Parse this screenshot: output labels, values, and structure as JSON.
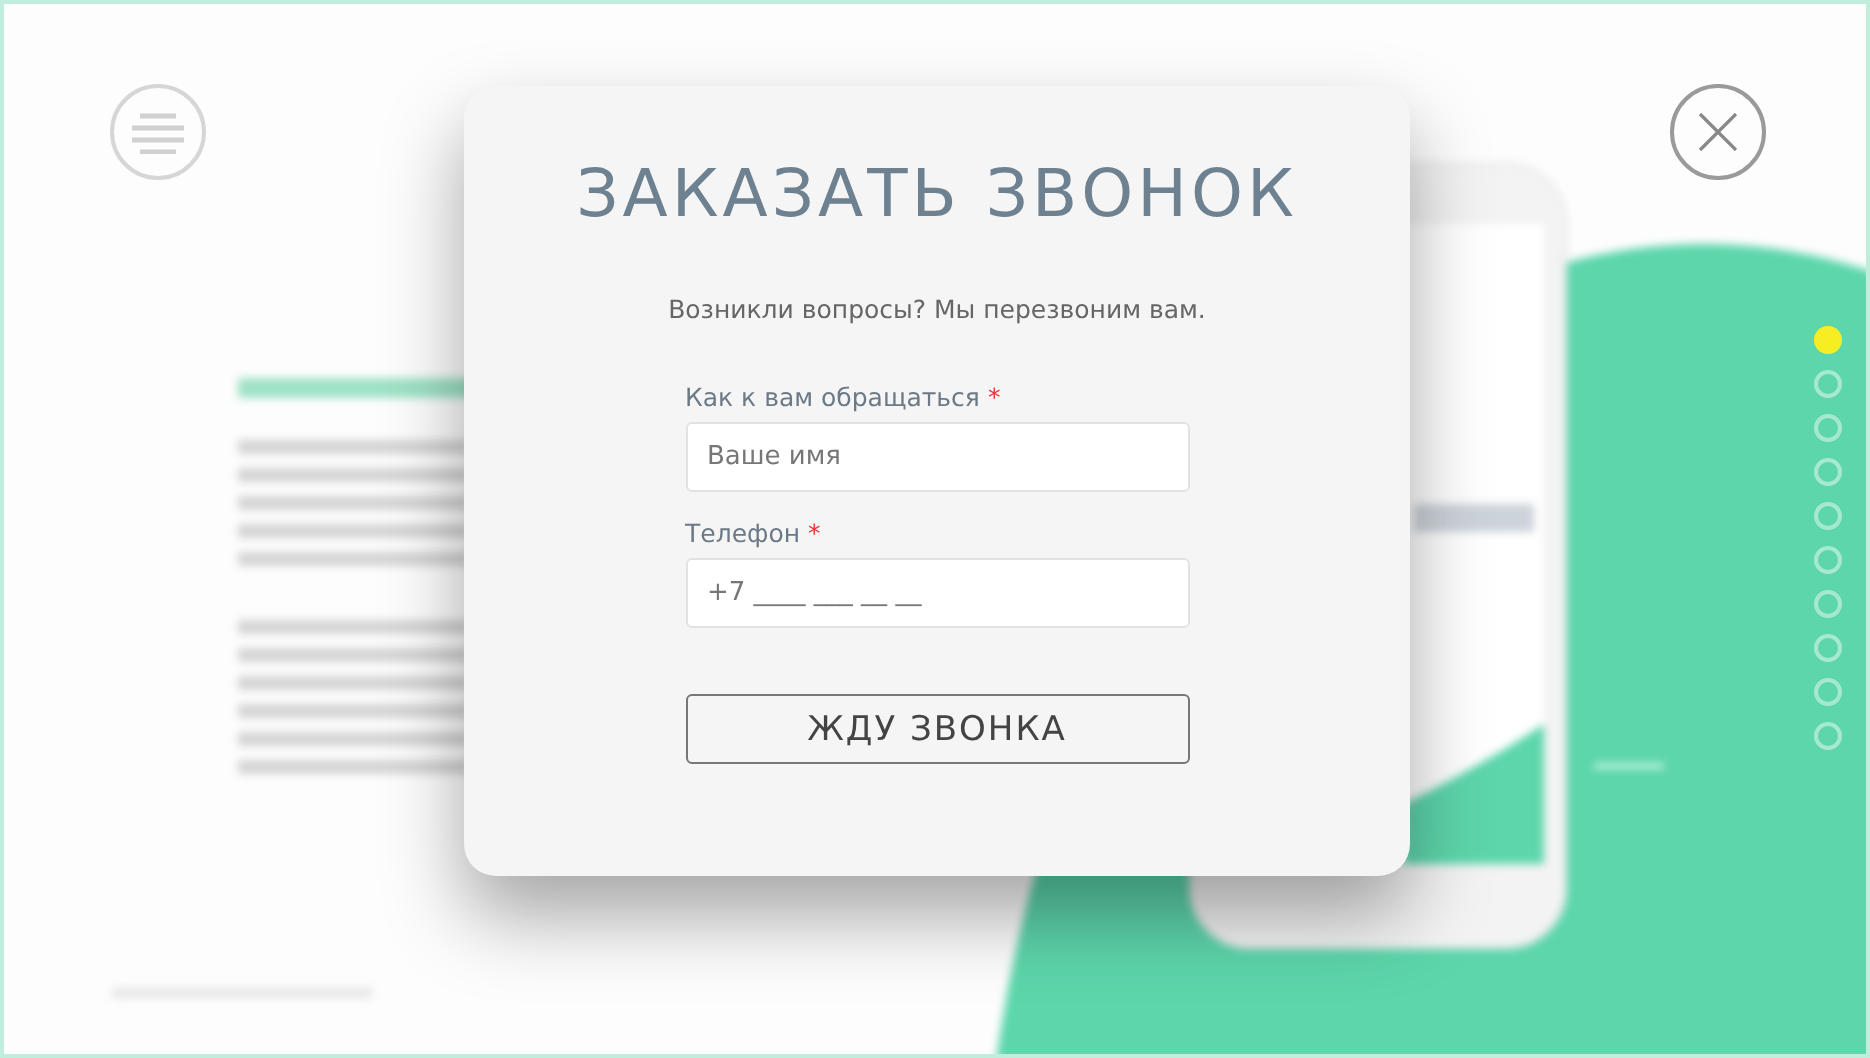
{
  "modal": {
    "title": "ЗАКАЗАТЬ ЗВОНОК",
    "subtitle": "Возникли вопросы? Мы перезвоним вам.",
    "fields": [
      {
        "label": "Как к вам обращаться",
        "required_mark": "*",
        "placeholder": "Ваше имя"
      },
      {
        "label": "Телефон",
        "required_mark": "*",
        "placeholder": "+7 ____ ___ __ __"
      }
    ],
    "submit": "ЖДУ ЗВОНКА"
  },
  "slide_dots": [
    {
      "selected": true
    },
    {
      "selected": false
    },
    {
      "selected": false
    },
    {
      "selected": false
    },
    {
      "selected": false
    },
    {
      "selected": false
    },
    {
      "selected": false
    },
    {
      "selected": false
    },
    {
      "selected": false
    },
    {
      "selected": false
    }
  ]
}
